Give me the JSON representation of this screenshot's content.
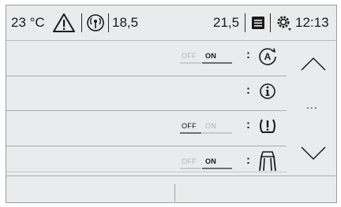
{
  "status_bar": {
    "temperature": "23 °C",
    "warning_icon": "warning-triangle-icon",
    "radio_icon": "radio-antenna-icon",
    "frequency": "18,5",
    "value_right": "21,5",
    "notes_icon": "notepad-icon",
    "settings_icon": "settings-gear-icon",
    "time": "12:13"
  },
  "settings_rows": [
    {
      "icon": "auto-stop-start-icon",
      "off_label": "OFF",
      "on_label": "ON",
      "state": "on",
      "separator": ":"
    },
    {
      "icon": "info-icon",
      "separator": ":"
    },
    {
      "icon": "tyre-pressure-warning-icon",
      "off_label": "OFF",
      "on_label": "ON",
      "state": "off",
      "separator": ":"
    },
    {
      "icon": "lane-assist-icon",
      "off_label": "OFF",
      "on_label": "ON",
      "state": "on",
      "separator": ":"
    }
  ],
  "nav": {
    "up_icon": "chevron-up-icon",
    "more": "...",
    "down_icon": "chevron-down-icon"
  },
  "colors": {
    "background": "#eaebec",
    "text": "#1a1a1a",
    "dim": "#b0b2b4",
    "divider": "#a9abad"
  }
}
